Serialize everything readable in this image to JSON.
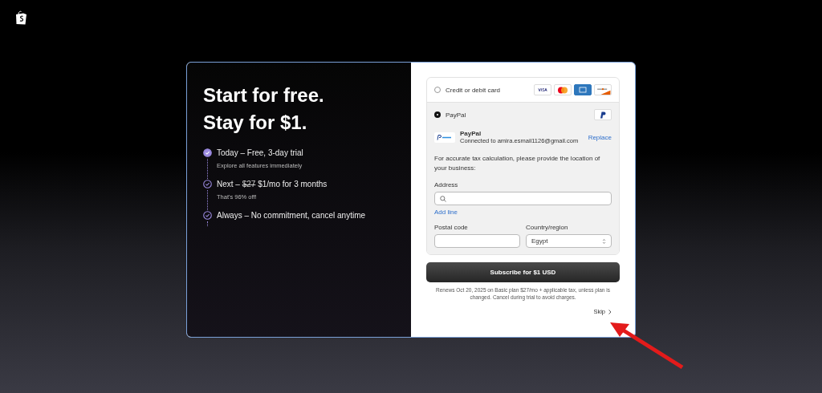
{
  "headline": [
    "Start for free.",
    "Stay for $1."
  ],
  "steps": [
    {
      "title": "Today – Free, 3-day trial",
      "note": "Explore all features immediately",
      "active": true
    },
    {
      "title": "Next –",
      "struck": "$27",
      "rest": "$1/mo for 3 months",
      "note": "That's 96% off!",
      "active": false
    },
    {
      "title": "Always – No commitment, cancel anytime",
      "active": false
    }
  ],
  "payment_methods": [
    {
      "kind": "card",
      "label": "Credit or debit card",
      "selected": false
    },
    {
      "kind": "paypal",
      "label": "PayPal",
      "selected": true,
      "account_name": "PayPal",
      "account_text": "Connected to amira.esmail1126@gmail.com",
      "replace_link": "Replace",
      "tax_note": "For accurate tax calculation, please provide the location of your business:",
      "address_label": "Address",
      "add_line": "Add line",
      "postal_label": "Postal code",
      "country_label": "Country/region",
      "country_value": "Egypt"
    }
  ],
  "subscribe_button": "Subscribe for $1 USD",
  "renewal_note": "Renews Oct 20, 2025 on Basic plan $27/mo + applicable tax, unless plan is changed. Cancel during trial to avoid charges.",
  "skip_link": "Skip"
}
